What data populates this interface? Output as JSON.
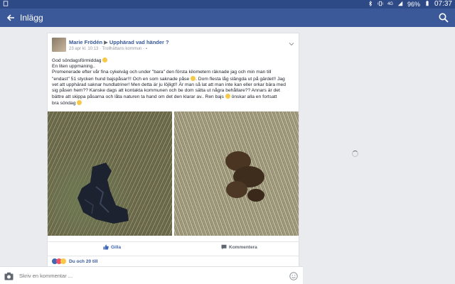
{
  "status_bar": {
    "notification_icon": "clipboard-icon",
    "icons": [
      "bluetooth-icon",
      "vibrate-icon",
      "wifi-icon",
      "signal-icon",
      "battery-icon"
    ],
    "network": "4G",
    "battery": "96%",
    "time": "07:37"
  },
  "app_bar": {
    "title": "Inlägg",
    "back_icon": "back-arrow-icon",
    "search_icon": "search-icon",
    "background": "#3b5998"
  },
  "post": {
    "author": "Marie Frödén",
    "group": "Upphärad vad händer ?",
    "meta": "23 apr kl. 10:13 · Trollhättans kommun ·",
    "lines": [
      "God söndagsförmiddag",
      "En liten uppmaning..",
      "Promenerade efter vår fina cykelväg och under \"bara\" den första kilometern räknade jag och min man till",
      "\"endast\" 51 stycken hund bajspåsar!!! Och en som saknade påse",
      ". Dom flesta låg slängda ut på gärdet!! Jag",
      "vet att upphärad saknar hundlatriner! Men detta är ju löjligt!! Är man så lat att man inte kan eller orkar bära med",
      "sig påsen hem?? Kanske dags att kontakta kommunen och be dom sätta ut några behållare?? Annars är det",
      "bättre att skippa påsarna och låta naturen ta hand om det den klarar av.. Ren bajs",
      " önskar alla en fortsatt",
      "bra söndag"
    ],
    "photos": [
      "dog-waste-bag-in-grass",
      "dog-waste-in-grass"
    ]
  },
  "actions": {
    "like_label": "Gilla",
    "comment_label": "Kommentera"
  },
  "reactions": {
    "text": "Du och 20 till",
    "icons": [
      "like-reaction-icon",
      "love-reaction-icon",
      "haha-reaction-icon"
    ]
  },
  "comment_bar": {
    "placeholder": "Skriv en kommentar ..."
  },
  "colors": {
    "brand": "#3b5998",
    "link": "#365899",
    "background": "#e9ebee"
  }
}
